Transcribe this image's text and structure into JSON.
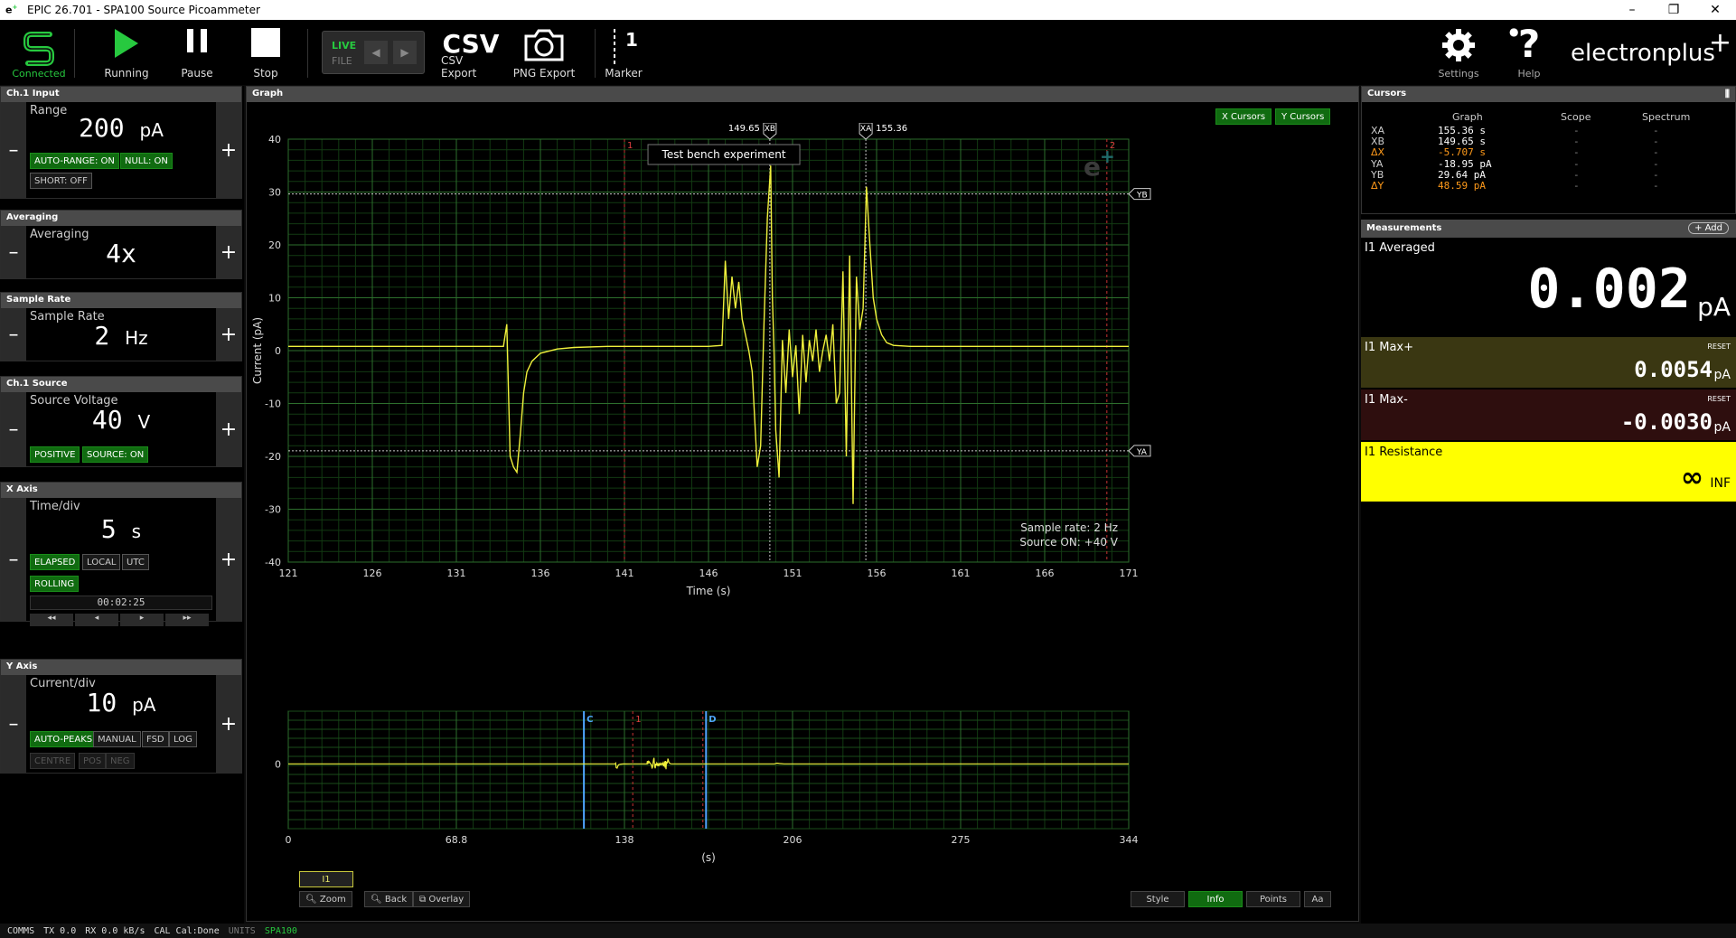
{
  "window": {
    "title": "EPIC 26.701 - SPA100 Source Picoammeter"
  },
  "toolbar": {
    "connected": "Connected",
    "running": "Running",
    "pause": "Pause",
    "stop": "Stop",
    "live": "LIVE",
    "file": "FILE",
    "csv_icon": "CSV",
    "csv_export": "CSV Export",
    "png_export": "PNG Export",
    "marker_num": "1",
    "marker": "Marker",
    "settings": "Settings",
    "help": "Help",
    "brand": "electronplus"
  },
  "colors": {
    "accent_green": "#27c93f",
    "trace": "#f0f03c",
    "grid": "#1f5a1f",
    "cursor_x": "#cccccc",
    "marker": "#d23c3c",
    "resistance_bg": "#ffff00"
  },
  "ch1_input": {
    "header": "Ch.1 Input",
    "label": "Range",
    "value": "200",
    "unit": "pA",
    "chip_autorange": "AUTO-RANGE: ON",
    "chip_null": "NULL: ON",
    "chip_short": "SHORT: OFF"
  },
  "averaging": {
    "header": "Averaging",
    "label": "Averaging",
    "value": "4x"
  },
  "sample_rate": {
    "header": "Sample Rate",
    "label": "Sample Rate",
    "value": "2",
    "unit": "Hz"
  },
  "ch1_source": {
    "header": "Ch.1 Source",
    "label": "Source Voltage",
    "value": "40",
    "unit": "V",
    "chip_positive": "POSITIVE",
    "chip_source": "SOURCE: ON"
  },
  "x_axis": {
    "header": "X Axis",
    "label": "Time/div",
    "value": "5",
    "unit": "s",
    "chip_elapsed": "ELAPSED",
    "chip_local": "LOCAL",
    "chip_utc": "UTC",
    "chip_rolling": "ROLLING",
    "clock": "00:02:25",
    "nav": [
      "◂◂",
      "◂",
      "▸",
      "▸▸"
    ]
  },
  "y_axis": {
    "header": "Y Axis",
    "label": "Current/div",
    "value": "10",
    "unit": "pA",
    "chip_autopeaks": "AUTO-PEAKS",
    "chip_manual": "MANUAL",
    "chip_fsd": "FSD",
    "chip_log": "LOG",
    "chip_centre": "CENTRE",
    "chip_pos": "POS",
    "chip_neg": "NEG"
  },
  "graph": {
    "header": "Graph",
    "x_cursors": "X Cursors",
    "y_cursors": "Y Cursors",
    "annotation": "Test bench experiment",
    "ylabel": "Current (pA)",
    "xlabel": "Time (s)",
    "xb_label": "XB",
    "xb_value": "149.65",
    "xa_label": "XA",
    "xa_value": "155.36",
    "ya_label": "YA",
    "yb_label": "YB",
    "marker1": "1",
    "marker2": "2",
    "info_rate": "Sample rate: 2 Hz",
    "info_source": "Source ON: +40 V",
    "overview_xlabel": "(s)",
    "overview_c": "C",
    "overview_d": "D",
    "overview_m1": "1",
    "series_btn": "I1",
    "zoom": "Zoom",
    "back": "Back",
    "overlay": "Overlay",
    "style": "Style",
    "info": "Info",
    "points": "Points",
    "aa": "Aa"
  },
  "chart_data": [
    {
      "type": "line",
      "ylabel": "Current (pA)",
      "xlabel": "Time (s)",
      "xlim": [
        121,
        171
      ],
      "ylim": [
        -40,
        40
      ],
      "xticks": [
        "121",
        "126",
        "131",
        "136",
        "141",
        "146",
        "151",
        "156",
        "161",
        "166",
        "171"
      ],
      "yticks": [
        "40",
        "30",
        "20",
        "10",
        "0",
        "-10",
        "-20",
        "-30",
        "-40"
      ],
      "series": [
        {
          "x": [
            121,
            133.8,
            134.0,
            134.2,
            134.4,
            134.6,
            134.8,
            135.0,
            135.2,
            135.5,
            136,
            137,
            138,
            140,
            146,
            146.8,
            147.0,
            147.2,
            147.4,
            147.6,
            147.8,
            148.0,
            148.2,
            148.4,
            148.6,
            148.9,
            149.1,
            149.3,
            149.5,
            149.7,
            149.8,
            149.9,
            150.0,
            150.2,
            150.4,
            150.6,
            150.8,
            151.0,
            151.2,
            151.4,
            151.6,
            151.8,
            152.0,
            152.2,
            152.4,
            152.6,
            152.8,
            153.0,
            153.2,
            153.4,
            153.6,
            153.8,
            154.0,
            154.2,
            154.4,
            154.6,
            154.8,
            155.0,
            155.2,
            155.4,
            155.6,
            155.8,
            156.0,
            156.3,
            156.6,
            157,
            158,
            171
          ],
          "y": [
            0.8,
            0.8,
            5,
            -20,
            -22,
            -23,
            -16,
            -8,
            -4,
            -2,
            -0.5,
            0.3,
            0.6,
            0.8,
            0.8,
            1,
            17,
            6,
            14,
            8,
            13,
            6,
            3,
            0,
            -4,
            -22,
            -18,
            5,
            25,
            35,
            10,
            0,
            -15,
            -24,
            2,
            -8,
            4,
            -5,
            1,
            -12,
            3,
            -6,
            2,
            -2,
            4,
            -4,
            0,
            3,
            -2,
            5,
            -10,
            -8,
            15,
            -20,
            18,
            -29,
            14,
            4,
            8,
            31,
            20,
            10,
            6,
            3,
            1.5,
            1,
            0.8,
            0.8
          ]
        }
      ]
    },
    {
      "type": "line",
      "xlabel": "(s)",
      "xlim": [
        0,
        344
      ],
      "xticks": [
        "0",
        "68.8",
        "138",
        "206",
        "275",
        "344"
      ],
      "yticks": [
        "0"
      ]
    }
  ],
  "cursors": {
    "header": "Cursors",
    "cols": [
      "Graph",
      "Scope",
      "Spectrum"
    ],
    "rows": [
      {
        "name": "XA",
        "graph": "155.36 s",
        "scope": "-",
        "spectrum": "-",
        "highlight": false
      },
      {
        "name": "XB",
        "graph": "149.65 s",
        "scope": "-",
        "spectrum": "-",
        "highlight": false
      },
      {
        "name": "ΔX",
        "graph": "-5.707 s",
        "scope": "-",
        "spectrum": "-",
        "highlight": true
      },
      {
        "name": "YA",
        "graph": "-18.95 pA",
        "scope": "-",
        "spectrum": "-",
        "highlight": false
      },
      {
        "name": "YB",
        "graph": "29.64 pA",
        "scope": "-",
        "spectrum": "-",
        "highlight": false
      },
      {
        "name": "ΔY",
        "graph": "48.59 pA",
        "scope": "-",
        "spectrum": "-",
        "highlight": true
      }
    ]
  },
  "measurements": {
    "header": "Measurements",
    "add": "+ Add",
    "avg_label": "I1 Averaged",
    "avg_value": "0.002",
    "avg_unit": "pA",
    "max_label": "I1 Max+",
    "max_reset": "RESET",
    "max_value": "0.0054",
    "max_unit": "pA",
    "min_label": "I1 Max-",
    "min_reset": "RESET",
    "min_value": "-0.0030",
    "min_unit": "pA",
    "res_label": "I1 Resistance",
    "res_value": "∞",
    "res_unit": "INF"
  },
  "status": {
    "comms": "COMMS",
    "tx": "TX 0.0",
    "rx": "RX 0.0 kB/s",
    "cal": "CAL Cal:Done",
    "units": "UNITS",
    "model": "SPA100"
  }
}
